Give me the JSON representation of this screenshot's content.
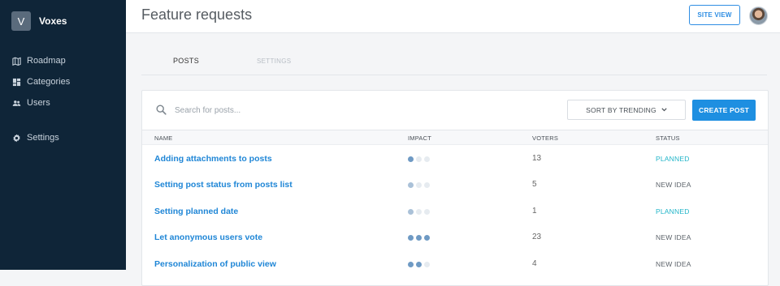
{
  "brand": {
    "initial": "V",
    "name": "Voxes"
  },
  "sidebar": {
    "items": [
      {
        "label": "Roadmap",
        "icon": "map-icon"
      },
      {
        "label": "Categories",
        "icon": "dashboard-icon"
      },
      {
        "label": "Users",
        "icon": "users-icon"
      },
      {
        "label": "Settings",
        "icon": "gear-icon"
      }
    ]
  },
  "header": {
    "title": "Feature requests",
    "site_view_label": "SITE VIEW"
  },
  "tabs": [
    {
      "label": "POSTS",
      "active": true
    },
    {
      "label": "SETTINGS",
      "active": false
    }
  ],
  "toolbar": {
    "search_placeholder": "Search for posts...",
    "sort_label": "SORT BY TRENDING",
    "create_label": "CREATE POST"
  },
  "table": {
    "columns": [
      "NAME",
      "IMPACT",
      "VOTERS",
      "STATUS"
    ],
    "rows": [
      {
        "name": "Adding attachments to posts",
        "impact": 1,
        "voters": "13",
        "status": "PLANNED"
      },
      {
        "name": "Setting post status from posts list",
        "impact": 0,
        "voters": "5",
        "status": "NEW IDEA"
      },
      {
        "name": "Setting planned date",
        "impact": 0,
        "voters": "1",
        "status": "PLANNED"
      },
      {
        "name": "Let anonymous users vote",
        "impact": 3,
        "voters": "23",
        "status": "NEW IDEA"
      },
      {
        "name": "Personalization of public view",
        "impact": 2,
        "voters": "4",
        "status": "NEW IDEA"
      }
    ]
  },
  "colors": {
    "sidebar_bg": "#0f2538",
    "accent": "#1e8fe1",
    "planned": "#22b5c9"
  }
}
